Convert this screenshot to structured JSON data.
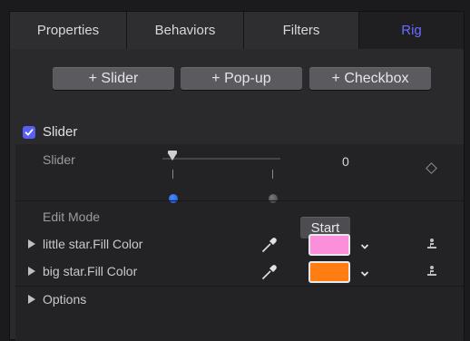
{
  "tabs": [
    {
      "label": "Properties"
    },
    {
      "label": "Behaviors"
    },
    {
      "label": "Filters"
    },
    {
      "label": "Rig"
    }
  ],
  "add_buttons": {
    "slider": "+ Slider",
    "popup": "+ Pop-up",
    "checkbox": "+ Checkbox"
  },
  "widget": {
    "enabled": true,
    "title": "Slider"
  },
  "slider_row": {
    "label": "Slider",
    "value": "0"
  },
  "edit_mode": {
    "label": "Edit Mode",
    "button": "Start"
  },
  "parameters": [
    {
      "label": "little star.Fill Color",
      "color": "#fb8fd9"
    },
    {
      "label": "big star.Fill Color",
      "color": "#ff7d12"
    }
  ],
  "options": {
    "label": "Options"
  },
  "colors": {
    "accent": "#5b5ef3",
    "keyframe_blue": "#1657d6"
  }
}
